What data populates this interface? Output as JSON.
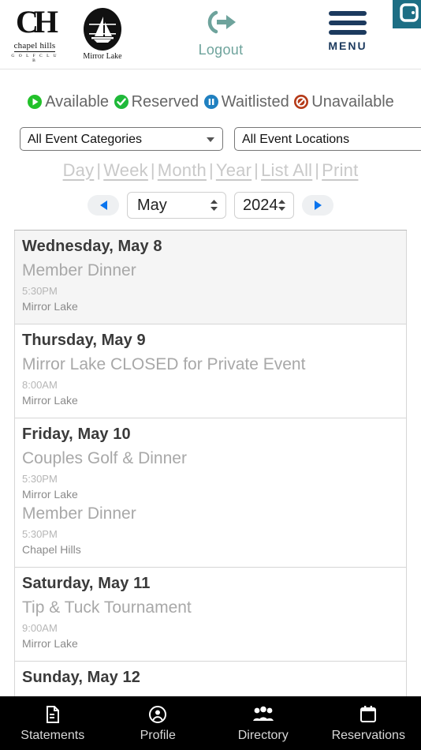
{
  "header": {
    "club_logo": {
      "monogram": "CH",
      "name": "chapel hills",
      "subtitle": "G O L F   C L U B"
    },
    "venue_logo": {
      "name": "Mirror Lake",
      "icon": "sailboat-icon"
    },
    "logout_label": "Logout",
    "menu_label": "MENU",
    "chat_badge_icon": "chat-widget-icon"
  },
  "legend": {
    "items": [
      {
        "label": "Available",
        "icon": "play-circle-icon",
        "color": "#22c12a"
      },
      {
        "label": "Reserved",
        "icon": "check-circle-icon",
        "color": "#1fb93a"
      },
      {
        "label": "Waitlisted",
        "icon": "pause-circle-icon",
        "color": "#2080c0"
      },
      {
        "label": "Unavailable",
        "icon": "block-circle-icon",
        "color": "#b53a18"
      }
    ]
  },
  "filters": {
    "category_select": {
      "value": "All Event Categories"
    },
    "location_select": {
      "value": "All Event Locations"
    }
  },
  "views": {
    "links": [
      "Day",
      "Week",
      "Month",
      "Year",
      "List All",
      "Print"
    ],
    "separator": "|"
  },
  "nav": {
    "prev_label": "◀",
    "next_label": "▶",
    "month": "May",
    "year": "2024"
  },
  "calendar": {
    "days": [
      {
        "date": "Wednesday, May 8",
        "shaded": true,
        "events": [
          {
            "title": "Member Dinner",
            "time": "5:30PM",
            "location": "Mirror Lake"
          }
        ]
      },
      {
        "date": "Thursday, May 9",
        "shaded": false,
        "events": [
          {
            "title": "Mirror Lake CLOSED for Private Event",
            "time": "8:00AM",
            "location": "Mirror Lake"
          }
        ]
      },
      {
        "date": "Friday, May 10",
        "shaded": false,
        "events": [
          {
            "title": "Couples Golf & Dinner",
            "time": "5:30PM",
            "location": "Mirror Lake"
          },
          {
            "title": "Member Dinner",
            "time": "5:30PM",
            "location": "Chapel Hills"
          }
        ]
      },
      {
        "date": "Saturday, May 11",
        "shaded": false,
        "events": [
          {
            "title": "Tip & Tuck Tournament",
            "time": "9:00AM",
            "location": "Mirror Lake"
          }
        ]
      },
      {
        "date": "Sunday, May 12",
        "shaded": false,
        "events": []
      }
    ]
  },
  "bottom_nav": {
    "items": [
      {
        "label": "Statements",
        "icon": "document-dollar-icon"
      },
      {
        "label": "Profile",
        "icon": "person-circle-icon"
      },
      {
        "label": "Directory",
        "icon": "people-group-icon"
      },
      {
        "label": "Reservations",
        "icon": "calendar-icon"
      }
    ]
  }
}
